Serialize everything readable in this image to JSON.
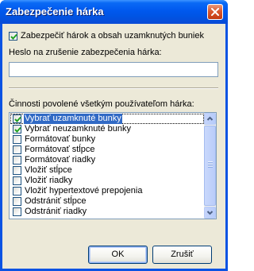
{
  "window": {
    "title": "Zabezpečenie hárka"
  },
  "protect_checkbox": {
    "checked": true,
    "label": "Zabezpečiť hárok a obsah uzamknutých buniek"
  },
  "password": {
    "label": "Heslo na zrušenie zabezpečenia hárka:",
    "value": ""
  },
  "permissions": {
    "label": "Činnosti povolené všetkým používateľom hárka:",
    "items": [
      {
        "label": "Vybrať uzamknuté bunky",
        "checked": true,
        "selected": true
      },
      {
        "label": "Vybrať neuzamknuté bunky",
        "checked": true,
        "selected": false
      },
      {
        "label": "Formátovať bunky",
        "checked": false,
        "selected": false
      },
      {
        "label": "Formátovať stĺpce",
        "checked": false,
        "selected": false
      },
      {
        "label": "Formátovať riadky",
        "checked": false,
        "selected": false
      },
      {
        "label": "Vložiť stĺpce",
        "checked": false,
        "selected": false
      },
      {
        "label": "Vložiť riadky",
        "checked": false,
        "selected": false
      },
      {
        "label": "Vložiť hypertextové prepojenia",
        "checked": false,
        "selected": false
      },
      {
        "label": "Odstrániť stĺpce",
        "checked": false,
        "selected": false
      },
      {
        "label": "Odstrániť riadky",
        "checked": false,
        "selected": false
      }
    ]
  },
  "buttons": {
    "ok": "OK",
    "cancel": "Zrušiť"
  },
  "icons": {
    "close": "close-icon",
    "check": "checkmark-icon",
    "scroll_up": "chevron-up-icon",
    "scroll_down": "chevron-down-icon"
  },
  "colors": {
    "titlebar": "#0054e3",
    "selection": "#316ac5",
    "check": "#21a121",
    "dialog_bg": "#ece9d8"
  }
}
